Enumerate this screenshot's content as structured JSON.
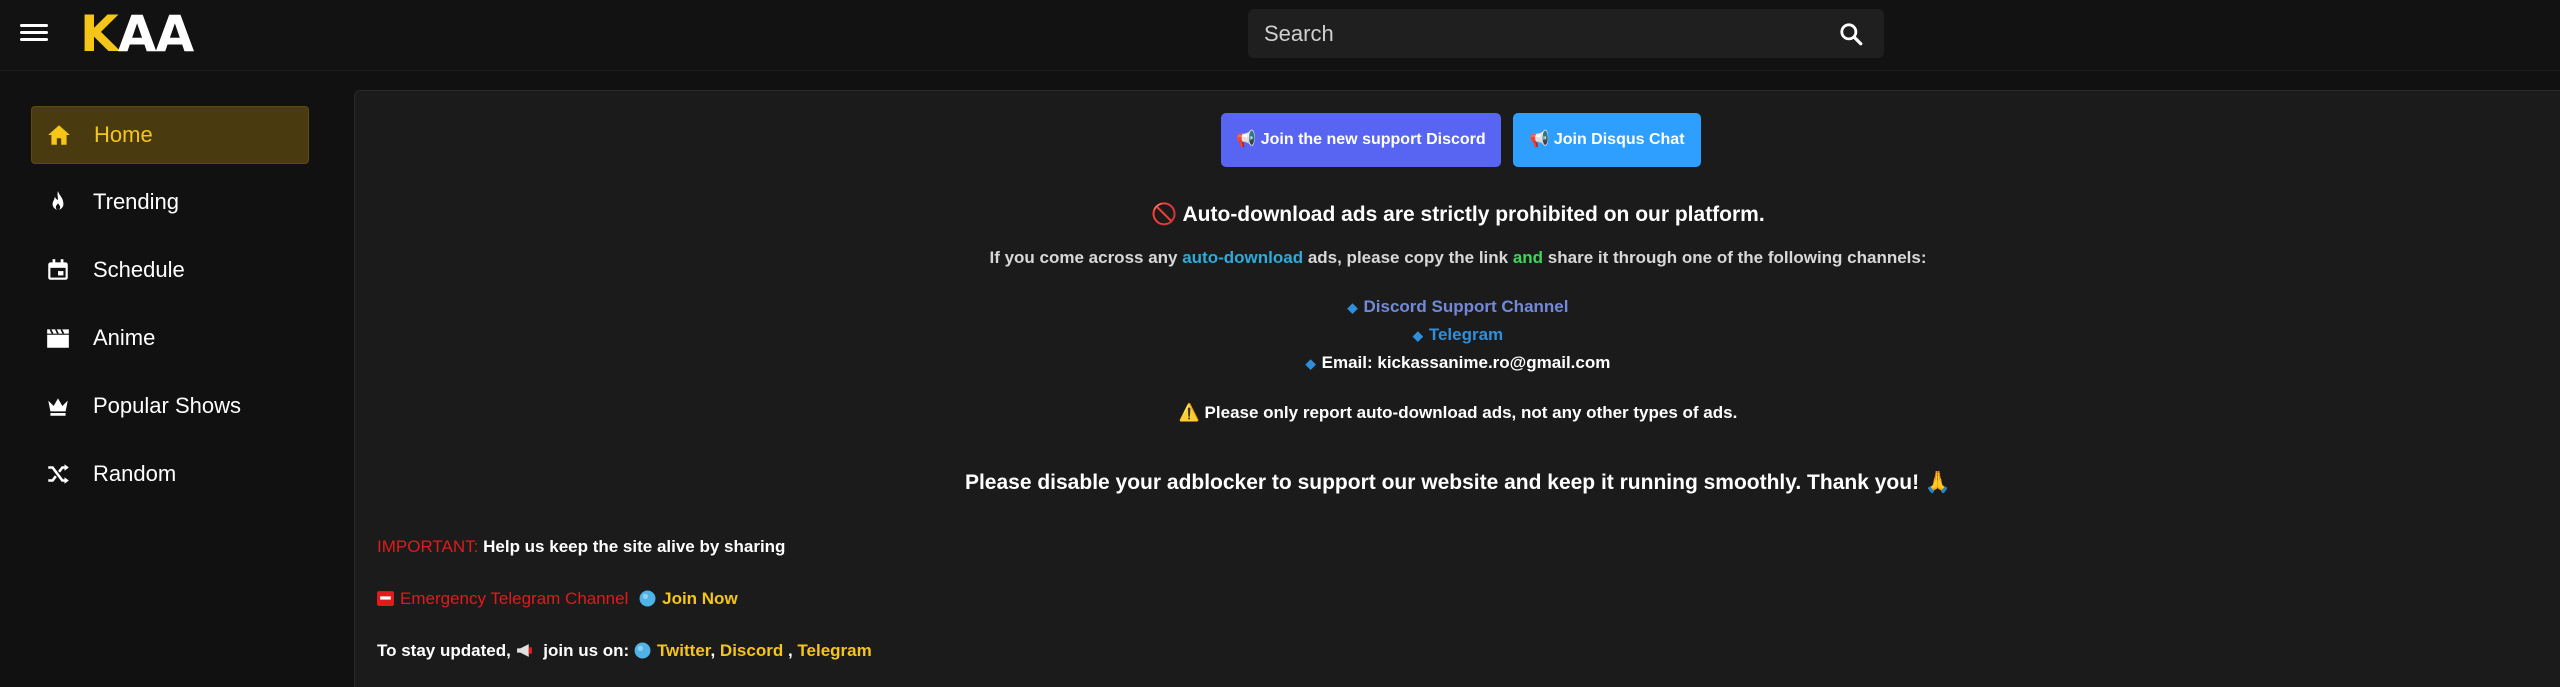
{
  "header": {
    "logo_first": "K",
    "logo_rest": "AA",
    "search_placeholder": "Search"
  },
  "sidebar": {
    "items": [
      {
        "label": "Home",
        "icon": "home-icon",
        "active": true
      },
      {
        "label": "Trending",
        "icon": "fire-icon"
      },
      {
        "label": "Schedule",
        "icon": "calendar-icon"
      },
      {
        "label": "Anime",
        "icon": "clapperboard-icon"
      },
      {
        "label": "Popular Shows",
        "icon": "crown-icon"
      },
      {
        "label": "Random",
        "icon": "shuffle-icon"
      }
    ]
  },
  "main": {
    "buttons": {
      "discord_label": "📢 Join the new support Discord",
      "disqus_label": "📢 Join Disqus Chat"
    },
    "notice_title": "🚫 Auto-download ads are strictly prohibited on our platform.",
    "notice_text": {
      "part1": "If you come across any ",
      "highlight1": "auto-download",
      "part2": " ads, please copy the link ",
      "highlight2": "and",
      "part3": " share it through one of the following channels:"
    },
    "channels": {
      "discord": "Discord Support Channel",
      "telegram": "Telegram",
      "email": "Email: kickassanime.ro@gmail.com"
    },
    "report_note": "⚠️ Please only report auto-download ads, not any other types of ads.",
    "adblock_note": "Please disable your adblocker to support our website and keep it running smoothly. Thank you! 🙏",
    "important": {
      "label": "IMPORTANT:",
      "text": " Help us keep the site alive by sharing"
    },
    "emergency": {
      "label": "Emergency Telegram Channel",
      "join": "Join Now"
    },
    "updates": {
      "prefix": "To stay updated, ",
      "join_text": " join us on: ",
      "twitter": "Twitter",
      "discord": "Discord",
      "telegram": "Telegram"
    }
  },
  "colors": {
    "accent": "#f5c518",
    "discord_button": "#5865f2",
    "disqus_button": "#2e9fff",
    "important_red": "#e01b1b"
  }
}
